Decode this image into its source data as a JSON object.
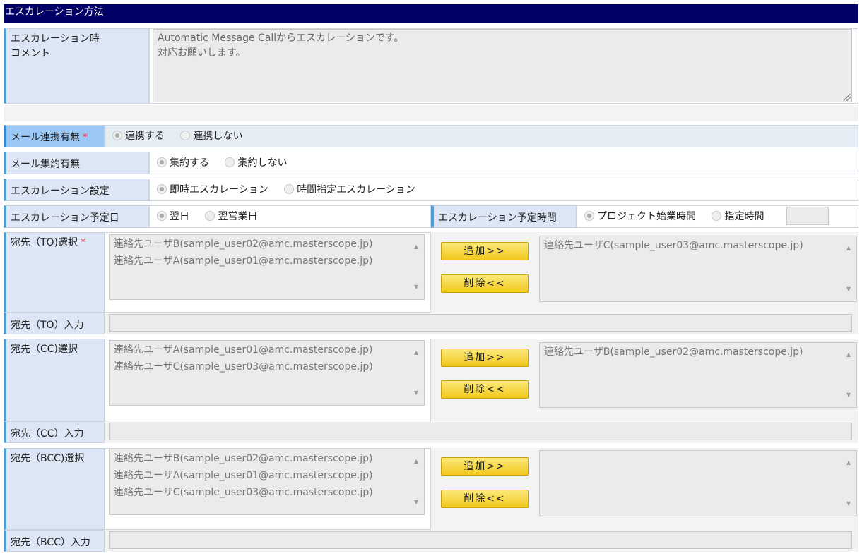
{
  "section_title": "エスカレーション方法",
  "comment": {
    "label_line1": "エスカレーション時",
    "label_line2": "コメント",
    "text": "Automatic Message Callからエスカレーションです。\n対応お願いします。"
  },
  "mail_link": {
    "label": "メール連携有無",
    "required": "*",
    "options": [
      "連携する",
      "連携しない"
    ],
    "selected": "連携する"
  },
  "mail_aggregate": {
    "label": "メール集約有無",
    "options": [
      "集約する",
      "集約しない"
    ],
    "selected": "集約する"
  },
  "escalation_setting": {
    "label": "エスカレーション設定",
    "options": [
      "即時エスカレーション",
      "時間指定エスカレーション"
    ],
    "selected": "即時エスカレーション"
  },
  "scheduled_date": {
    "label": "エスカレーション予定日",
    "options": [
      "翌日",
      "翌営業日"
    ],
    "selected": "翌日"
  },
  "scheduled_time": {
    "label": "エスカレーション予定時間",
    "options": [
      "プロジェクト始業時間",
      "指定時間"
    ],
    "selected": "プロジェクト始業時間",
    "time_value": ""
  },
  "buttons": {
    "add": "追加>>",
    "remove": "削除<<"
  },
  "to": {
    "select_label": "宛先（TO)選択",
    "required": "*",
    "input_label": "宛先（TO）入力",
    "available": [
      "連絡先ユーザB(sample_user02@amc.masterscope.jp)",
      "連絡先ユーザA(sample_user01@amc.masterscope.jp)"
    ],
    "selected": [
      "連絡先ユーザC(sample_user03@amc.masterscope.jp)"
    ],
    "input_value": ""
  },
  "cc": {
    "select_label": "宛先（CC)選択",
    "input_label": "宛先（CC）入力",
    "available": [
      "連絡先ユーザA(sample_user01@amc.masterscope.jp)",
      "連絡先ユーザC(sample_user03@amc.masterscope.jp)"
    ],
    "selected": [
      "連絡先ユーザB(sample_user02@amc.masterscope.jp)"
    ],
    "input_value": ""
  },
  "bcc": {
    "select_label": "宛先（BCC)選択",
    "input_label": "宛先（BCC）入力",
    "available": [
      "連絡先ユーザB(sample_user02@amc.masterscope.jp)",
      "連絡先ユーザA(sample_user01@amc.masterscope.jp)",
      "連絡先ユーザC(sample_user03@amc.masterscope.jp)"
    ],
    "selected": [],
    "input_value": ""
  }
}
